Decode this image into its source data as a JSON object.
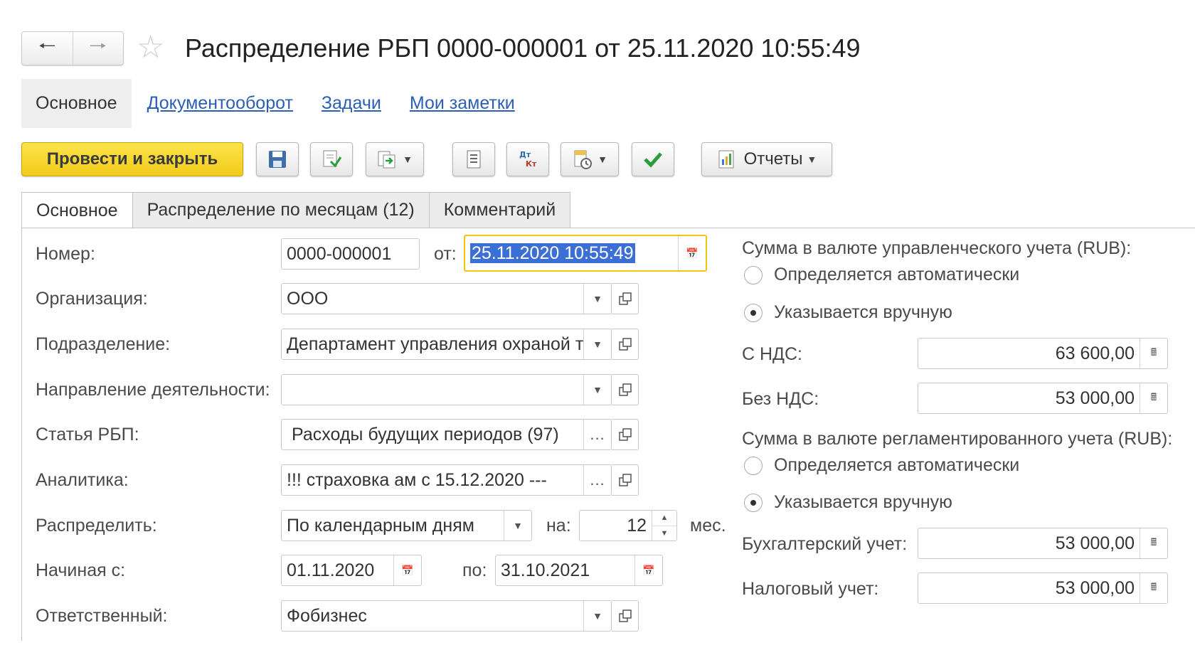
{
  "window": {
    "title": "Распределение РБП 0000-000001 от 25.11.2020 10:55:49"
  },
  "topnav": {
    "items": [
      "Основное",
      "Документооборот",
      "Задачи",
      "Мои заметки"
    ]
  },
  "toolbar": {
    "post_close_label": "Провести и закрыть",
    "reports_label": "Отчеты",
    "dt_kt_label": "Дт Кт"
  },
  "tabs": [
    "Основное",
    "Распределение по месяцам (12)",
    "Комментарий"
  ],
  "form": {
    "number_label": "Номер:",
    "number_value": "0000-000001",
    "date_label": "от:",
    "date_value": "25.11.2020 10:55:49",
    "org_label": "Организация:",
    "org_value": "ООО",
    "dept_label": "Подразделение:",
    "dept_value": "Департамент управления охраной тру,",
    "direction_label": "Направление деятельности:",
    "direction_value": "",
    "article_label": "Статья РБП:",
    "article_value": "Расходы будущих периодов (97)",
    "analytics_label": "Аналитика:",
    "analytics_value": "!!! страховка ам с 15.12.2020 ---",
    "distribute_label": "Распределить:",
    "distribute_value": "По календарным дням",
    "na_label": "на:",
    "months_value": "12",
    "months_unit": "мес.",
    "start_label": "Начиная с:",
    "start_value": "01.11.2020",
    "to_label": "по:",
    "end_value": "31.10.2021",
    "responsible_label": "Ответственный:",
    "responsible_value": "Фобизнес"
  },
  "mgmt": {
    "heading": "Сумма в валюте управленческого учета (RUB):",
    "opt_auto": "Определяется автоматически",
    "opt_manual": "Указывается вручную",
    "selected": "manual",
    "vat_label": "С НДС:",
    "vat_value": "63 600,00",
    "novat_label": "Без НДС:",
    "novat_value": "53 000,00"
  },
  "reg": {
    "heading": "Сумма в валюте регламентированного учета (RUB):",
    "opt_auto": "Определяется автоматически",
    "opt_manual": "Указывается вручную",
    "selected": "manual",
    "acc_label": "Бухгалтерский учет:",
    "acc_value": "53 000,00",
    "tax_label": "Налоговый учет:",
    "tax_value": "53 000,00"
  },
  "icons": [
    "back-arrow-icon",
    "forward-arrow-icon",
    "favorite-star-icon",
    "save-icon",
    "post-icon",
    "create-based-on-icon",
    "list-icon",
    "dt-kt-icon",
    "print-icon",
    "check-icon",
    "reports-icon",
    "calendar-icon",
    "calculator-icon",
    "dropdown-arrow-icon",
    "open-icon",
    "spinner-icon"
  ],
  "colors": {
    "primary_button": "#f5d024",
    "link": "#2b5fb7",
    "selection": "#3b6fd6",
    "focus": "#f1c40f",
    "check": "#2a9d3a"
  }
}
